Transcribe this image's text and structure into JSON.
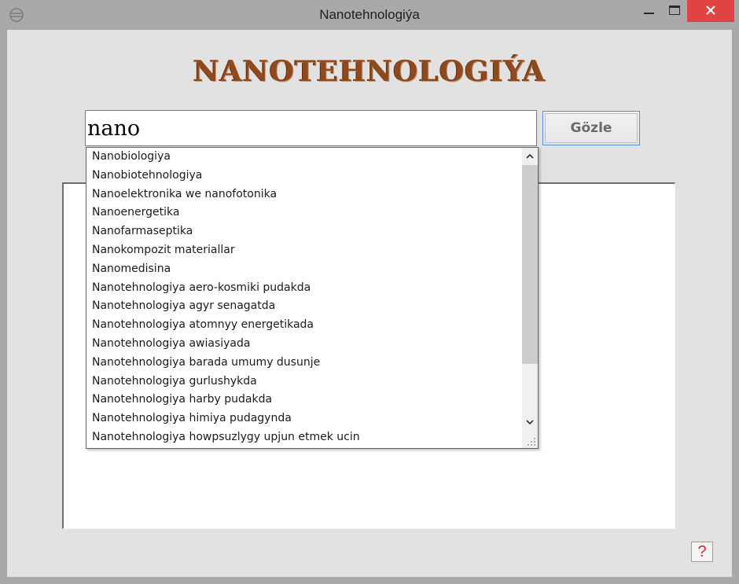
{
  "window": {
    "title": "Nanotehnologiýa",
    "icon": "app-icon",
    "controls": [
      "minimize-icon",
      "maximize-icon",
      "close-icon"
    ],
    "close_color": "#e04343"
  },
  "header": {
    "heading": "NANOTEHNOLOGIÝA",
    "heading_color": "#8e4a1c"
  },
  "search": {
    "value": "nano",
    "button_label": "Gözle"
  },
  "suggestions": {
    "items": [
      "Nanobiologiya",
      "Nanobiotehnologiya",
      "Nanoelektronika we nanofotonika",
      "Nanoenergetika",
      "Nanofarmaseptika",
      "Nanokompozit materiallar",
      "Nanomedisina",
      "Nanotehnologiya aero-kosmiki pudakda",
      "Nanotehnologiya agyr senagatda",
      "Nanotehnologiya atomnyy energetikada",
      "Nanotehnologiya awiasiyada",
      "Nanotehnologiya barada umumy dusunje",
      "Nanotehnologiya gurlushykda",
      "Nanotehnologiya harby pudakda",
      "Nanotehnologiya himiya pudagynda",
      "Nanotehnologiya howpsuzlygy upjun etmek ucin"
    ],
    "scroll_up_icon": "chevron-up-icon",
    "scroll_down_icon": "chevron-down-icon"
  },
  "help": {
    "label": "?",
    "color": "#e3202a"
  }
}
